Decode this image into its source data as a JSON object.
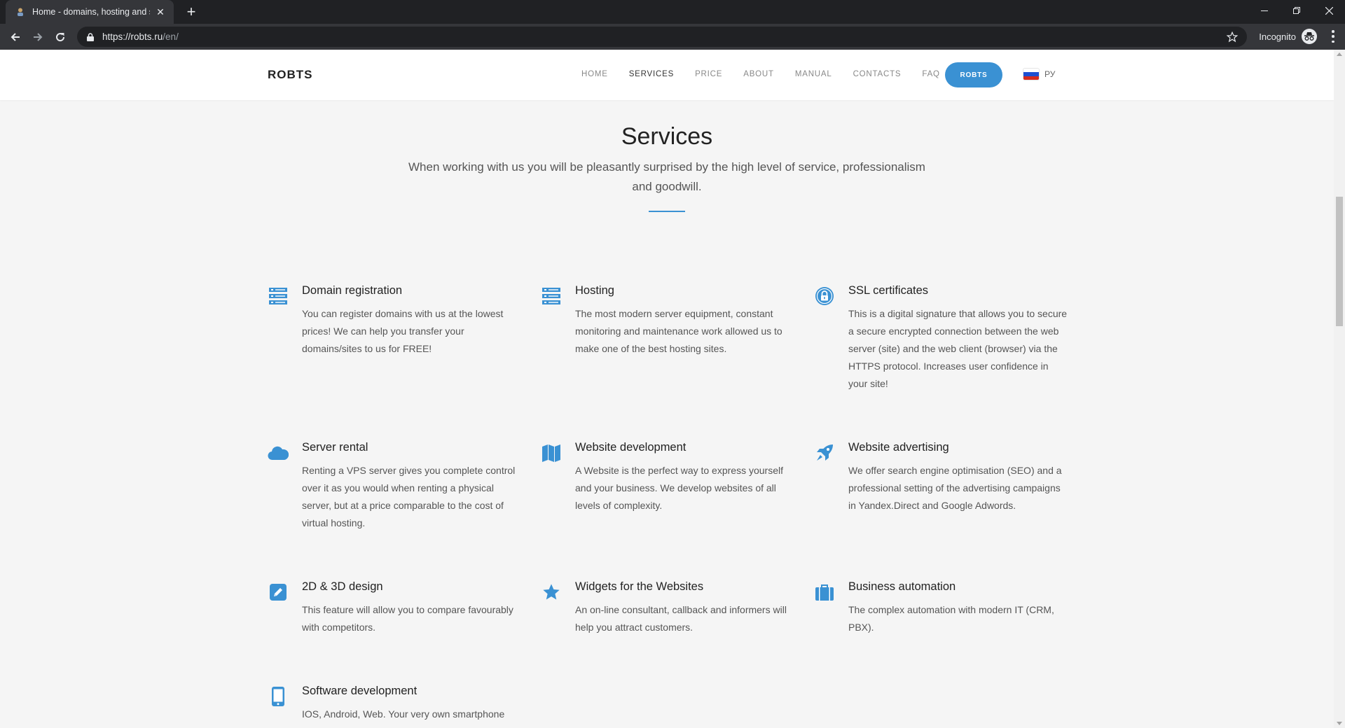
{
  "browser": {
    "tab_title": "Home - domains, hosting and se",
    "new_tab_icon": "plus-icon",
    "url_host": "https://robts.ru",
    "url_path": "/en/",
    "incognito_label": "Incognito",
    "window_controls": [
      "minimize-icon",
      "restore-icon",
      "close-icon"
    ]
  },
  "site": {
    "logo": "ROBTS",
    "nav": [
      {
        "label": "HOME",
        "active": false
      },
      {
        "label": "SERVICES",
        "active": true
      },
      {
        "label": "PRICE",
        "active": false
      },
      {
        "label": "ABOUT",
        "active": false
      },
      {
        "label": "MANUAL",
        "active": false
      },
      {
        "label": "CONTACTS",
        "active": false
      },
      {
        "label": "FAQ",
        "active": false
      }
    ],
    "cta_label": "ROBTS",
    "lang_label": "РУ",
    "accent_color": "#3a91d3"
  },
  "section": {
    "title": "Services",
    "subtitle": "When working with us you will be pleasantly surprised by the high level of service, professionalism and goodwill."
  },
  "features": [
    {
      "title": "Domain registration",
      "desc": "You can register domains with us at the lowest prices! We can help you transfer your domains/sites to us for FREE!",
      "icon": "server-stack-icon"
    },
    {
      "title": "Hosting",
      "desc": "The most modern server equipment, constant monitoring and maintenance work allowed us to make one of the best hosting sites.",
      "icon": "server-stack-icon"
    },
    {
      "title": "SSL certificates",
      "desc": "This is a digital signature that allows you to secure a secure encrypted connection between the web server (site) and the web client (browser) via the HTTPS protocol. Increases user confidence in your site!",
      "icon": "lock-icon"
    },
    {
      "title": "Server rental",
      "desc": "Renting a VPS server gives you complete control over it as you would when renting a physical server, but at a price comparable to the cost of virtual hosting.",
      "icon": "cloud-icon"
    },
    {
      "title": "Website development",
      "desc": "A Website is the perfect way to express yourself and your business. We develop websites of all levels of complexity.",
      "icon": "map-icon"
    },
    {
      "title": "Website advertising",
      "desc": "We offer search engine optimisation (SEO) and a professional setting of the advertising campaigns in Yandex.Direct and Google Adwords.",
      "icon": "rocket-icon"
    },
    {
      "title": "2D & 3D design",
      "desc": "This feature will allow you to compare favourably with competitors.",
      "icon": "pencil-icon"
    },
    {
      "title": "Widgets for the Websites",
      "desc": "An on-line consultant, callback and informers will help you attract customers.",
      "icon": "star-icon"
    },
    {
      "title": "Business automation",
      "desc": "The complex automation with modern IT (CRM, PBX).",
      "icon": "briefcase-icon"
    },
    {
      "title": "Software development",
      "desc": "IOS, Android, Web. Your very own smartphone",
      "icon": "smartphone-icon"
    }
  ]
}
